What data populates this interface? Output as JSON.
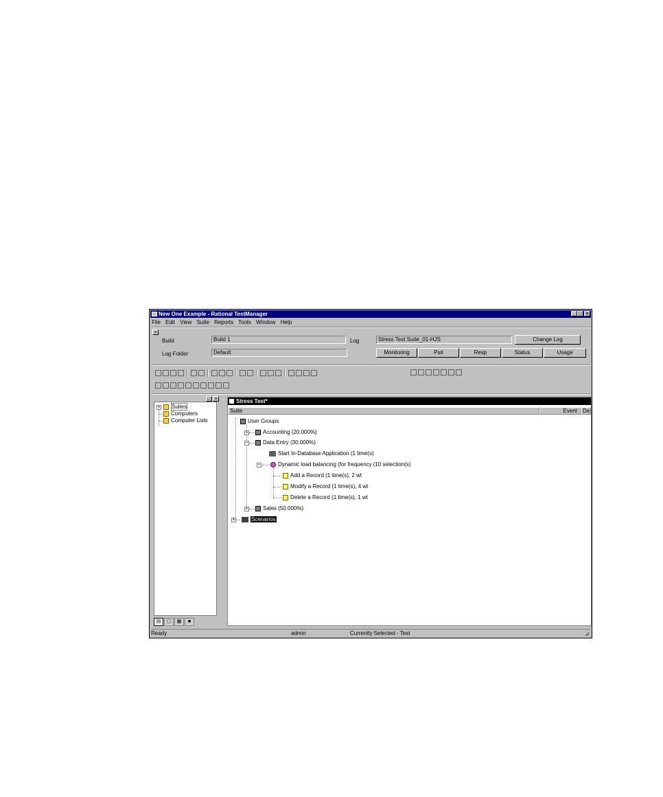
{
  "window": {
    "title": "New One Example - Rational TestManager"
  },
  "menu": [
    "File",
    "Edit",
    "View",
    "Suite",
    "Reports",
    "Tools",
    "Window",
    "Help"
  ],
  "form": {
    "build_label": "Build",
    "build_value": "Build 1",
    "log_label": "Log",
    "log_value": "Stress Test Suite_01-HJS",
    "logfolder_label": "Log Folder",
    "logfolder_value": "Default",
    "change_log_button": "Change Log",
    "monitor_buttons": [
      "Monitoring",
      "Ps#",
      "Resp",
      "Status",
      "Usage"
    ]
  },
  "left_panel": {
    "items": [
      "Suites",
      "Computers",
      "Computer Lists"
    ]
  },
  "document": {
    "title": "Stress Test*",
    "columns": [
      "Suite",
      "Event",
      "De"
    ],
    "tree": {
      "root": "User Groups",
      "groups": [
        {
          "label": "Accounting (20.000%)"
        },
        {
          "label": "Data Entry (30.000%)"
        }
      ],
      "delay": "Start In-Database Application (1 time(s)",
      "selector": "Dynamic load balancing (for frequency (10 selection(s)",
      "scripts": [
        "Add a Record (1 time(s), 2 wt",
        "Modify a Record (1 time(s), 4 wt",
        "Delete a Record (1 time(s), 1 wt"
      ],
      "sales": "Sales (50.000%)",
      "scenarios": "Scenarios"
    }
  },
  "status": {
    "left": "Ready",
    "user": "admin",
    "info": "Currently Selected - Test"
  }
}
